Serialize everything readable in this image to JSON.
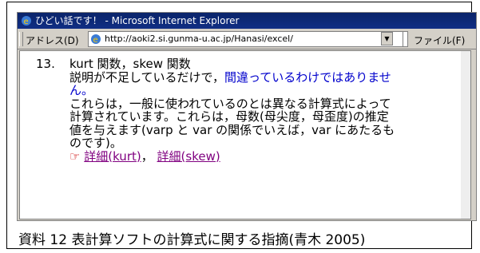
{
  "window": {
    "title": "ひどい話です！ - Microsoft Internet Explorer"
  },
  "address_bar": {
    "label": "アドレス(D)",
    "url": "http://aoki2.si.gunma-u.ac.jp/Hanasi/excel/",
    "file_menu": "ファイル(F)"
  },
  "content": {
    "item_number": "13.",
    "heading": "kurt 関数，skew 関数",
    "line2a": "説明が不足しているだけで，",
    "line2b": "間違っているわけではありませ",
    "line3": "ん。",
    "line4": "これらは，一般に使われているのとは異なる計算式によって",
    "line5": "計算されています。これらは，母数(母尖度，母歪度)の推定",
    "line6": "値を与えます(varp と var の関係でいえば，var にあたるも",
    "line7": "のです)。",
    "hand_glyph": "☞",
    "link1": "詳細(kurt)",
    "link_sep": "，",
    "link2": "詳細(skew)"
  },
  "caption": "資料 12  表計算ソフトの計算式に関する指摘(青木  2005)"
}
